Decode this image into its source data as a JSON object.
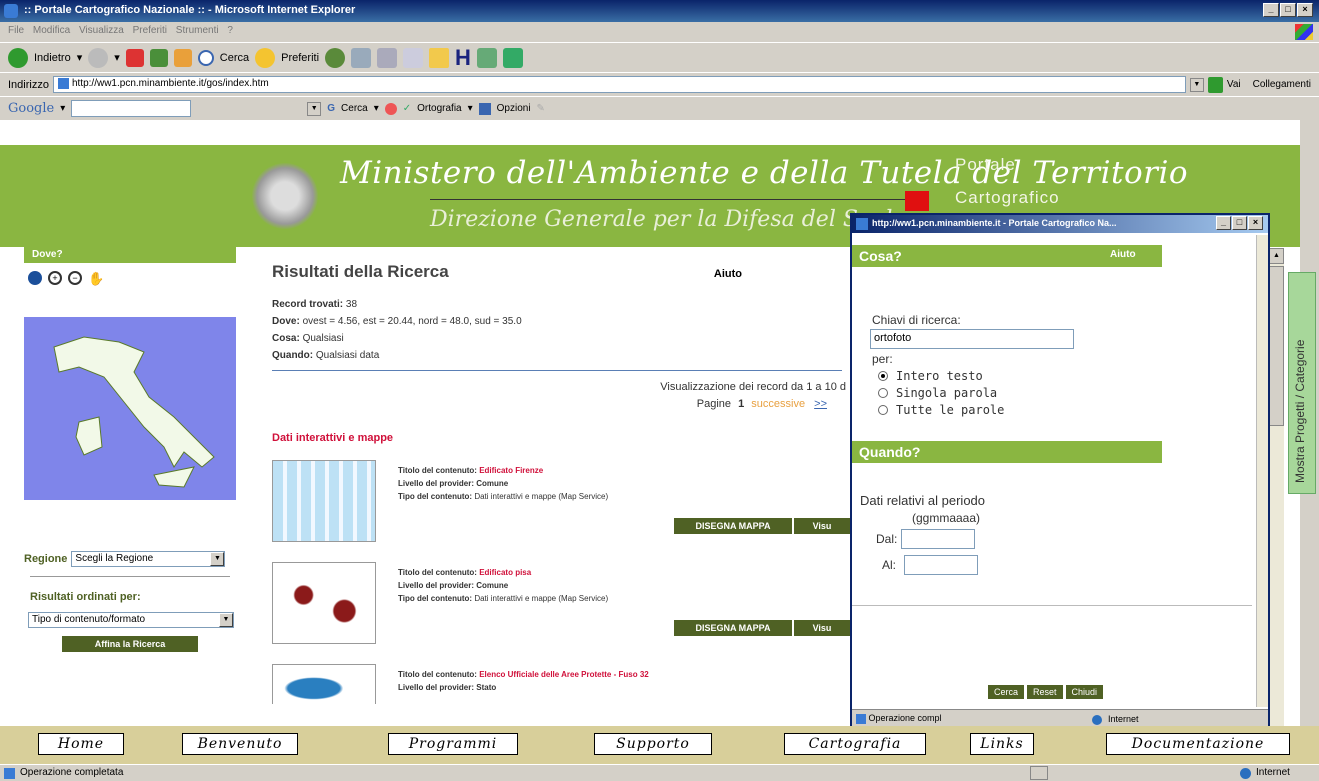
{
  "browser": {
    "window_title": ":: Portale Cartografico Nazionale :: - Microsoft Internet Explorer",
    "menu": [
      "File",
      "Modifica",
      "Visualizza",
      "Preferiti",
      "Strumenti",
      "?"
    ],
    "toolbar": {
      "back": "Indietro",
      "search": "Cerca",
      "favorites": "Preferiti"
    },
    "address_label": "Indirizzo",
    "address_url": "http://ww1.pcn.minambiente.it/gos/index.htm",
    "go_label": "Vai",
    "links_label": "Collegamenti",
    "google": {
      "logo": "Google",
      "search": "Cerca",
      "spelling": "Ortografia",
      "options": "Opzioni"
    }
  },
  "banner": {
    "ministry": "Ministero dell'Ambiente e della Tutela del Territorio",
    "direction": "Direzione Generale per la Difesa del Suolo",
    "portal_line1": "Portale",
    "portal_line2": "Cartografico"
  },
  "left": {
    "where_label": "Dove?",
    "region_label": "Regione",
    "region_value": "Scegli la Regione",
    "sort_label": "Risultati ordinati per:",
    "sort_value": "Tipo di contenuto/formato",
    "refine_button": "Affina la Ricerca"
  },
  "results": {
    "title": "Risultati della Ricerca",
    "help": "Aiuto",
    "found_label": "Record trovati:",
    "found_value": "38",
    "where_label": "Dove:",
    "where_value": "ovest = 4.56, est = 20.44, nord = 48.0, sud = 35.0",
    "what_label": "Cosa:",
    "what_value": "Qualsiasi",
    "when_label": "Quando:",
    "when_value": "Qualsiasi data",
    "showing": "Visualizzazione dei record da 1 a 10 d",
    "pages_label": "Pagine",
    "page_current": "1",
    "page_next": "successive",
    "page_arrows": ">>",
    "section": "Dati interattivi e mappe",
    "title_label": "Titolo del contenuto:",
    "provider_label": "Livello del provider:",
    "type_label": "Tipo del contenuto:",
    "draw_button": "DISEGNA MAPPA",
    "view_button": "Visu",
    "items": [
      {
        "title": "Edificato Firenze",
        "provider": "Comune",
        "type": "Dati interattivi e mappe (Map Service)"
      },
      {
        "title": "Edificato pisa",
        "provider": "Comune",
        "type": "Dati interattivi e mappe (Map Service)"
      },
      {
        "title": "Elenco Ufficiale delle Aree Protette - Fuso 32",
        "provider": "Stato",
        "type": ""
      }
    ]
  },
  "popup": {
    "title": "http://ww1.pcn.minambiente.it - Portale Cartografico Na...",
    "what_header": "Cosa?",
    "help": "Aiuto",
    "keys_label": "Chiavi di ricerca:",
    "keys_value": "ortofoto",
    "per_label": "per:",
    "options": [
      "Intero testo",
      "Singola parola",
      "Tutte le parole"
    ],
    "selected_option": "Intero testo",
    "when_header": "Quando?",
    "period_label": "Dati relativi al periodo",
    "date_format": "(ggmmaaaa)",
    "from_label": "Dal:",
    "to_label": "Al:",
    "buttons": [
      "Cerca",
      "Reset",
      "Chiudi"
    ],
    "status": "Operazione compl",
    "zone": "Internet"
  },
  "side_tab": "Mostra Progetti / Categorie",
  "nav": [
    "Home",
    "Benvenuto",
    "Programmi",
    "Supporto",
    "Cartografia",
    "Links",
    "Documentazione"
  ],
  "status": {
    "text": "Operazione completata",
    "zone": "Internet"
  },
  "colors": {
    "green": "#8ab641",
    "dark_green": "#4f6124",
    "red_link": "#d0103a",
    "map_blue": "#7f85ea"
  }
}
